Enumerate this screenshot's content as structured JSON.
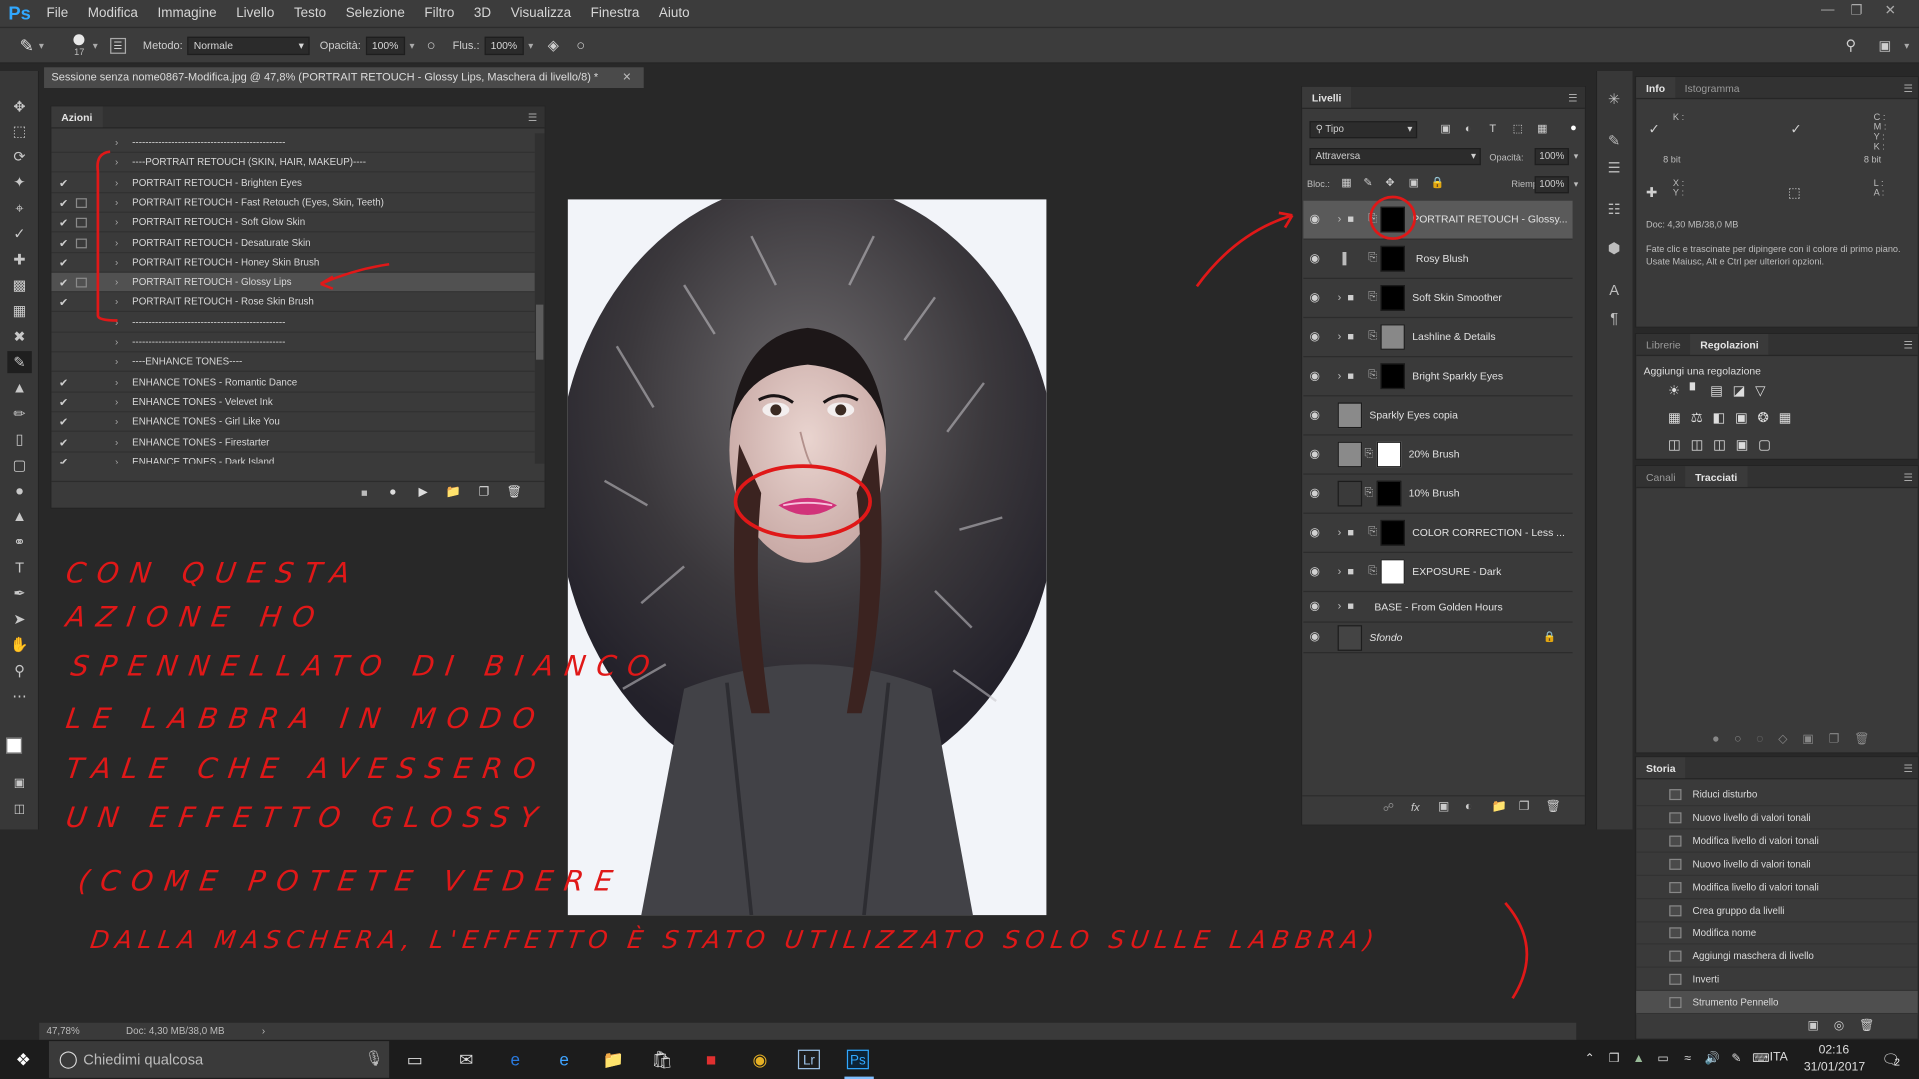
{
  "app": {
    "logo": "Ps"
  },
  "menu": [
    "File",
    "Modifica",
    "Immagine",
    "Livello",
    "Testo",
    "Selezione",
    "Filtro",
    "3D",
    "Visualizza",
    "Finestra",
    "Aiuto"
  ],
  "options": {
    "brush_size": "17",
    "metodo_label": "Metodo:",
    "metodo_value": "Normale",
    "opacita_label": "Opacità:",
    "opacita_value": "100%",
    "flusso_label": "Flus.:",
    "flusso_value": "100%"
  },
  "document": {
    "tab_title": "Sessione senza nome0867-Modifica.jpg @ 47,8% (PORTRAIT RETOUCH - Glossy Lips, Maschera di livello/8) *",
    "zoom": "47,78%",
    "doc_info": "Doc: 4,30 MB/38,0 MB"
  },
  "actions_panel": {
    "tab": "Azioni",
    "rows": [
      {
        "label": "-----------------------------------------------",
        "checked": false,
        "dialog": false,
        "selected": false
      },
      {
        "label": "----PORTRAIT RETOUCH (SKIN, HAIR, MAKEUP)----",
        "checked": false,
        "dialog": false,
        "selected": false
      },
      {
        "label": "PORTRAIT RETOUCH - Brighten Eyes",
        "checked": true,
        "dialog": false,
        "selected": false
      },
      {
        "label": "PORTRAIT RETOUCH - Fast Retouch (Eyes, Skin, Teeth)",
        "checked": true,
        "dialog": true,
        "selected": false
      },
      {
        "label": "PORTRAIT RETOUCH - Soft Glow Skin",
        "checked": true,
        "dialog": true,
        "selected": false
      },
      {
        "label": "PORTRAIT RETOUCH - Desaturate Skin",
        "checked": true,
        "dialog": true,
        "selected": false
      },
      {
        "label": "PORTRAIT RETOUCH - Honey Skin Brush",
        "checked": true,
        "dialog": false,
        "selected": false
      },
      {
        "label": "PORTRAIT RETOUCH - Glossy Lips",
        "checked": true,
        "dialog": true,
        "selected": true
      },
      {
        "label": "PORTRAIT RETOUCH - Rose Skin Brush",
        "checked": true,
        "dialog": false,
        "selected": false
      },
      {
        "label": "-----------------------------------------------",
        "checked": false,
        "dialog": false,
        "selected": false
      },
      {
        "label": "-----------------------------------------------",
        "checked": false,
        "dialog": false,
        "selected": false
      },
      {
        "label": "----ENHANCE TONES----",
        "checked": false,
        "dialog": false,
        "selected": false
      },
      {
        "label": "ENHANCE TONES - Romantic Dance",
        "checked": true,
        "dialog": false,
        "selected": false
      },
      {
        "label": "ENHANCE TONES - Velevet Ink",
        "checked": true,
        "dialog": false,
        "selected": false
      },
      {
        "label": "ENHANCE TONES - Girl Like You",
        "checked": true,
        "dialog": false,
        "selected": false
      },
      {
        "label": "ENHANCE TONES - Firestarter",
        "checked": true,
        "dialog": false,
        "selected": false
      },
      {
        "label": "ENHANCE TONES - Dark Island",
        "checked": true,
        "dialog": false,
        "selected": false
      }
    ]
  },
  "layers_panel": {
    "tab": "Livelli",
    "filter": "Tipo",
    "blend": "Attraversa",
    "opacity_label": "Opacità:",
    "opacity": "100%",
    "lock_label": "Bloc.:",
    "fill_label": "Riemp.:",
    "fill": "100%",
    "layers": [
      {
        "name": "PORTRAIT RETOUCH - Glossy...",
        "type": "group",
        "thumb": "#000000",
        "selected": true
      },
      {
        "name": "Rosy Blush",
        "type": "adjust",
        "thumb": "#000000",
        "selected": false
      },
      {
        "name": "Soft Skin Smoother",
        "type": "group",
        "thumb": "#000000",
        "selected": false
      },
      {
        "name": "Lashline & Details",
        "type": "group",
        "thumb": "#888888",
        "selected": false
      },
      {
        "name": "Bright Sparkly Eyes",
        "type": "group",
        "thumb": "#000000",
        "selected": false
      },
      {
        "name": "Sparkly Eyes copia",
        "type": "pixel",
        "thumb": "#8a8a8a",
        "selected": false
      },
      {
        "name": "20% Brush",
        "type": "pixel",
        "thumb": "#ffffff",
        "selected": false
      },
      {
        "name": "10% Brush",
        "type": "pixel",
        "thumb": "#000000",
        "selected": false
      },
      {
        "name": "COLOR CORRECTION - Less ...",
        "type": "group",
        "thumb": "#000000",
        "selected": false
      },
      {
        "name": "EXPOSURE - Dark",
        "type": "group",
        "thumb": "#ffffff",
        "selected": false
      },
      {
        "name": "BASE - From Golden Hours",
        "type": "group",
        "thumb": "",
        "selected": false
      },
      {
        "name": "Sfondo",
        "type": "background",
        "thumb": "#444444",
        "selected": false
      }
    ]
  },
  "info_panel": {
    "tabs": [
      "Info",
      "Istogramma"
    ],
    "k_label": "K :",
    "c_label": "C :",
    "m_label": "M :",
    "y_label": "Y :",
    "k2_label": "K :",
    "bit_left": "8 bit",
    "bit_right": "8 bit",
    "x_label": "X :",
    "y2_label": "Y :",
    "l_label": "L :",
    "a_label": "A :",
    "doc": "Doc: 4,30 MB/38,0 MB",
    "hint": "Fate clic e trascinate per dipingere con il colore di primo piano. Usate Maiusc, Alt e Ctrl per ulteriori opzioni."
  },
  "adjust_panel": {
    "tabs": [
      "Librerie",
      "Regolazioni"
    ],
    "heading": "Aggiungi una regolazione"
  },
  "channels_panel": {
    "tabs": [
      "Canali",
      "Tracciati"
    ]
  },
  "history_panel": {
    "tab": "Storia",
    "rows": [
      "Riduci disturbo",
      "Nuovo livello di valori tonali",
      "Modifica livello di valori tonali",
      "Nuovo livello di valori tonali",
      "Modifica livello di valori tonali",
      "Crea gruppo da livelli",
      "Modifica nome",
      "Aggiungi maschera di livello",
      "Inverti",
      "Strumento Pennello"
    ]
  },
  "annotation": {
    "lines": [
      "CON QUESTA",
      "AZIONE HO",
      "SPENNELLATO DI BIANCO",
      "LE LABBRA IN MODO",
      "TALE CHE AVESSERO",
      "UN EFFETTO GLOSSY",
      "(COME POTETE VEDERE",
      "DALLA MASCHERA, L'EFFETTO È STATO UTILIZZATO SOLO SULLE LABBRA)"
    ],
    "color": "#e01818"
  },
  "taskbar": {
    "search_placeholder": "Chiedimi qualcosa",
    "lang": "ITA",
    "time": "02:16",
    "date": "31/01/2017",
    "notifications": "2"
  }
}
